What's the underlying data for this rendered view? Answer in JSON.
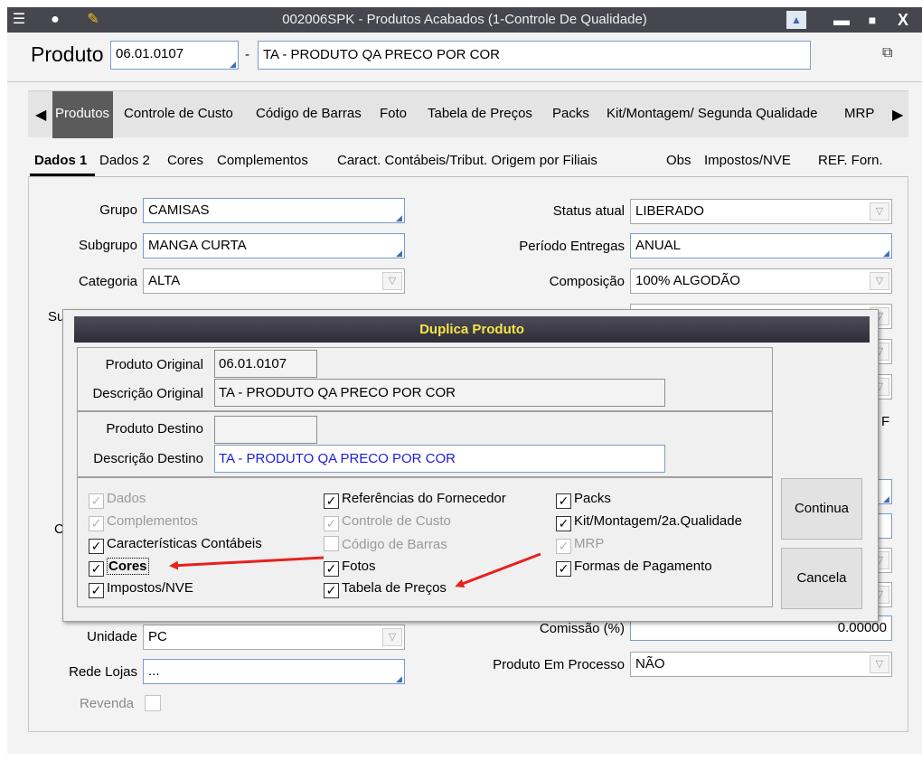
{
  "window": {
    "title": "002006SPK - Produtos Acabados (1-Controle De Qualidade)",
    "minimize": "▬",
    "maximize": "■",
    "close": "X"
  },
  "header": {
    "produto_label": "Produto",
    "produto_code": "06.01.0107",
    "separator": "-",
    "produto_desc": "TA - PRODUTO QA PRECO POR COR"
  },
  "tabs": [
    "Produtos",
    "Controle de Custo",
    "Código de Barras",
    "Foto",
    "Tabela de Preços",
    "Packs",
    "Kit/Montagem/ Segunda Qualidade",
    "MRP"
  ],
  "subtabs": [
    "Dados 1",
    "Dados 2",
    "Cores",
    "Complementos",
    "Caract. Contábeis/Tribut. Origem por Filiais",
    "Obs",
    "Impostos/NVE",
    "REF. Forn."
  ],
  "form": {
    "grupo_label": "Grupo",
    "grupo_value": "CAMISAS",
    "subgrupo_label": "Subgrupo",
    "subgrupo_value": "MANGA CURTA",
    "categoria_label": "Categoria",
    "categoria_value": "ALTA",
    "status_label": "Status atual",
    "status_value": "LIBERADO",
    "periodo_label": "Período Entregas",
    "periodo_value": "ANUAL",
    "composicao_label": "Composição",
    "composicao_value": "100% ALGODÃO",
    "unidade_label": "Unidade",
    "unidade_value": "PC",
    "rede_label": "Rede Lojas",
    "rede_value": "...",
    "revenda_label": "Revenda",
    "comissao_label": "Comissão (%)",
    "comissao_value": "0.00000",
    "processo_label": "Produto Em Processo",
    "processo_value": "NÃO",
    "hidden_su": "Su",
    "hidden_c": "C",
    "hidden_f": "F"
  },
  "dialog": {
    "title": "Duplica Produto",
    "orig_label": "Produto Original",
    "orig_code": "06.01.0107",
    "desc_orig_label": "Descrição  Original",
    "desc_orig_value": "TA - PRODUTO QA PRECO POR COR",
    "dest_label": "Produto Destino",
    "dest_code": "",
    "desc_dest_label": "Descrição  Destino",
    "desc_dest_value": "TA - PRODUTO QA PRECO POR COR",
    "checks": [
      {
        "label": "Dados",
        "checked": true,
        "disabled": true
      },
      {
        "label": "Complementos",
        "checked": true,
        "disabled": true
      },
      {
        "label": "Características Contábeis",
        "checked": true,
        "disabled": false
      },
      {
        "label": "Cores",
        "checked": true,
        "disabled": false
      },
      {
        "label": "Impostos/NVE",
        "checked": true,
        "disabled": false
      },
      {
        "label": "Referências do Fornecedor",
        "checked": true,
        "disabled": false
      },
      {
        "label": "Controle de Custo",
        "checked": true,
        "disabled": true
      },
      {
        "label": "Código de Barras",
        "checked": false,
        "disabled": true
      },
      {
        "label": "Fotos",
        "checked": true,
        "disabled": false
      },
      {
        "label": "Tabela de Preços",
        "checked": true,
        "disabled": false
      },
      {
        "label": "Packs",
        "checked": true,
        "disabled": false
      },
      {
        "label": "Kit/Montagem/2a.Qualidade",
        "checked": true,
        "disabled": false
      },
      {
        "label": "MRP",
        "checked": true,
        "disabled": true
      },
      {
        "label": "Formas de Pagamento",
        "checked": true,
        "disabled": false
      }
    ],
    "continua": "Continua",
    "cancela": "Cancela"
  },
  "colors": {
    "titlebar": "#46464e",
    "dialog_title_text": "#f5e44a",
    "arrow": "#e8201e",
    "active_tab": "#5b5b5b"
  }
}
